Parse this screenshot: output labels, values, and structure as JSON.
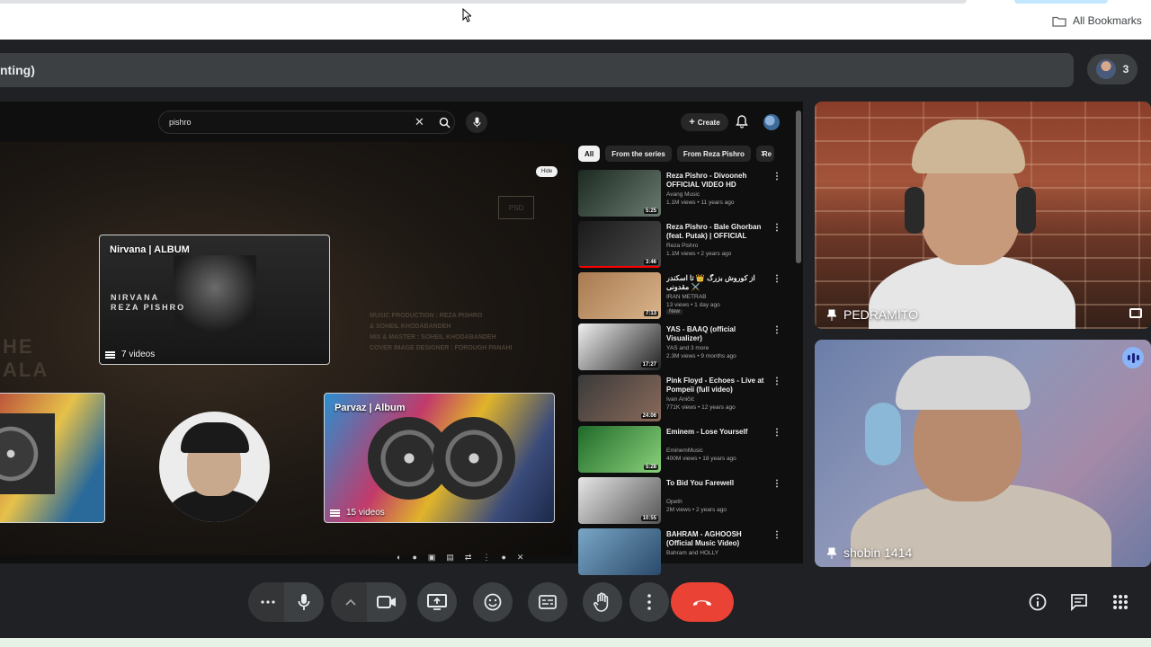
{
  "browser": {
    "bookmarks_label": "All Bookmarks"
  },
  "meet": {
    "presentation_title": "nting)",
    "participant_count": "3",
    "participants": [
      {
        "name": "PEDRAMITO"
      },
      {
        "name": "shobin 1414"
      }
    ]
  },
  "youtube": {
    "search_value": "pishro",
    "create_label": "Create",
    "hide_label": "Hide",
    "filter_chips": [
      {
        "label": "All",
        "active": true
      },
      {
        "label": "From the series",
        "active": false
      },
      {
        "label": "From Reza Pishro",
        "active": false
      },
      {
        "label": "Re",
        "active": false
      }
    ],
    "player": {
      "watermark_lines": [
        "HE",
        "ALA"
      ],
      "credits": [
        "MUSIC PRODUCTION : REZA PISHRO",
        "& SOHEIL KHODABANDEH",
        "MIX & MASTER : SOHEIL KHODABANDEH",
        "COVER IMAGE DESIGNER : FOROUGH PANAHI"
      ],
      "cards": [
        {
          "title": "Nirvana | ALBUM",
          "count": "7 videos",
          "art_text": "NIRVANA\nREZA PISHRO"
        },
        {
          "title": "Parvaz | Album",
          "count": "15 videos"
        }
      ]
    },
    "videos": [
      {
        "title": "Reza Pishro - Divooneh OFFICIAL VIDEO HD",
        "channel": "Avang Music",
        "stats": "1.1M views • 11 years ago",
        "duration": "5:25",
        "thumb": [
          "#1c2a22",
          "#6a7a70"
        ],
        "progress": 0
      },
      {
        "title": "Reza Pishro - Bale Ghorban (feat. Putak) | OFFICIAL TRAC...",
        "channel": "Reza Pishro",
        "stats": "1.1M views • 2 years ago",
        "duration": "3:46",
        "thumb": [
          "#1a1a1a",
          "#4a4a4a"
        ],
        "progress": 1
      },
      {
        "title": "از کوروش بزرگ 👑 تا اسکندر مقدونی ⚔️",
        "channel": "IRAN METRAB",
        "stats": "13 views • 1 day ago",
        "badge": "New",
        "duration": "7:13",
        "thumb": [
          "#a87a52",
          "#d9b48a"
        ],
        "progress": 0
      },
      {
        "title": "YAS - BAAQ (official Visualizer)",
        "channel": "YAS and 3 more",
        "stats": "2.3M views • 9 months ago",
        "duration": "17:27",
        "thumb": [
          "#f0f0f0",
          "#222222"
        ],
        "progress": 0
      },
      {
        "title": "Pink Floyd - Echoes - Live at Pompeii (full video)",
        "channel": "Ivan Aničić",
        "stats": "771K views • 12 years ago",
        "duration": "24:06",
        "thumb": [
          "#3a3a3a",
          "#8a6a5a"
        ],
        "progress": 0
      },
      {
        "title": "Eminem - Lose Yourself",
        "channel": "EminemMusic",
        "stats": "400M views • 18 years ago",
        "duration": "5:28",
        "thumb": [
          "#1f6a2a",
          "#8ad17a"
        ],
        "progress": 0
      },
      {
        "title": "To Bid You Farewell",
        "channel": "Opeth",
        "stats": "2M views • 2 years ago",
        "duration": "10:55",
        "thumb": [
          "#e6e6e6",
          "#555555"
        ],
        "progress": 0
      },
      {
        "title": "BAHRAM - AGHOOSH (Official Music Video)",
        "channel": "Bahram and HOLLY",
        "stats": "",
        "duration": "",
        "thumb": [
          "#7aa6c6",
          "#2a4a6a"
        ],
        "progress": 0
      }
    ]
  },
  "colors": {
    "end_call": "#ea4335",
    "control_bg": "#3c4043",
    "accent_blue": "#8ab4f8"
  },
  "icons": {
    "controls": [
      "more-options-icon",
      "microphone-icon",
      "chevron-up-icon",
      "camera-icon",
      "present-screen-icon",
      "emoji-icon",
      "captions-icon",
      "raise-hand-icon",
      "more-vert-icon",
      "end-call-icon"
    ],
    "side": [
      "info-icon",
      "chat-icon",
      "apps-icon"
    ]
  }
}
